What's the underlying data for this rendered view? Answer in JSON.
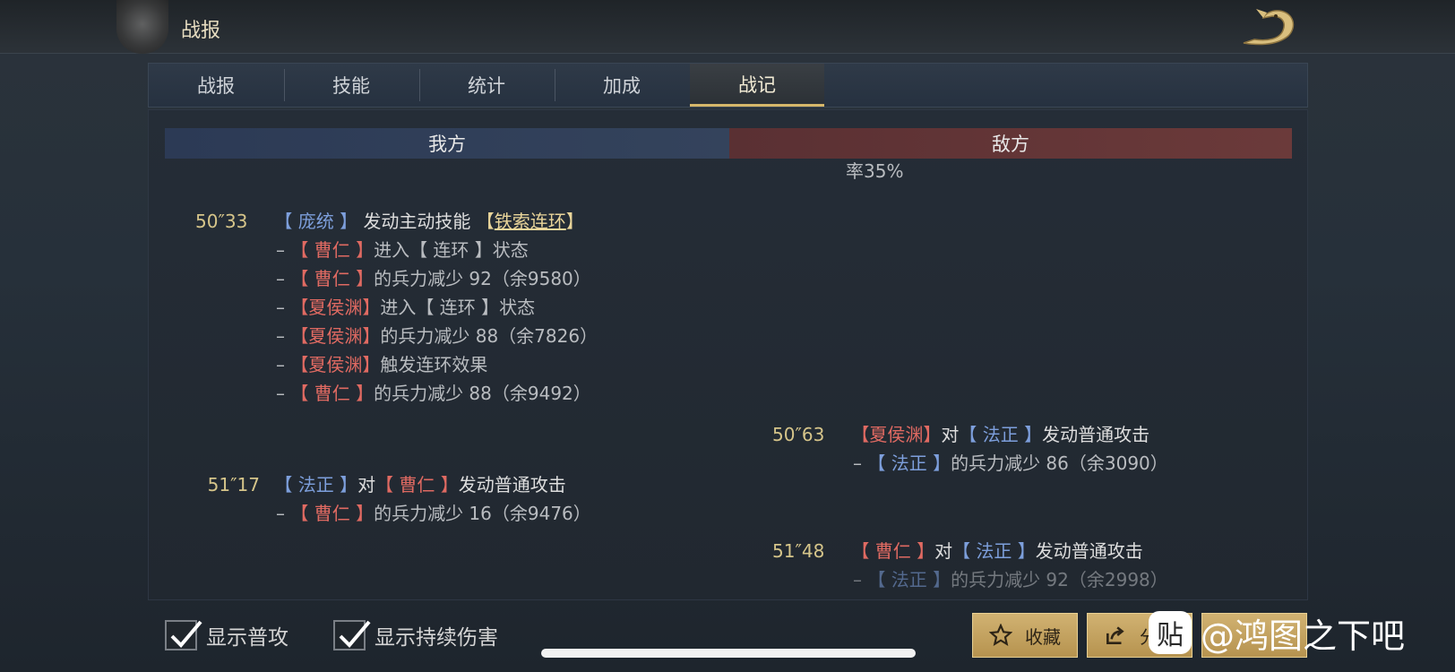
{
  "header": {
    "title": "战报"
  },
  "tabs": [
    {
      "label": "战报"
    },
    {
      "label": "技能"
    },
    {
      "label": "统计"
    },
    {
      "label": "加成"
    },
    {
      "label": "战记",
      "active": true
    }
  ],
  "sides": {
    "our": "我方",
    "enemy": "敌方"
  },
  "log": {
    "partial_top_line": "率35%",
    "e1": {
      "time": "50″33",
      "actor": "【 庞统 】",
      "verb": "发动主动技能",
      "skill_open": "【",
      "skill": "铁索连环",
      "skill_close": "】",
      "subs": [
        {
          "target": "【 曹仁 】",
          "pre": "进入",
          "status": "【 连环 】",
          "post": "状态"
        },
        {
          "target": "【 曹仁 】",
          "text": "的兵力减少 92（余9580）"
        },
        {
          "target": "【夏侯渊】",
          "pre": "进入",
          "status": "【 连环 】",
          "post": "状态"
        },
        {
          "target": "【夏侯渊】",
          "text": "的兵力减少 88（余7826）"
        },
        {
          "target": "【夏侯渊】",
          "text": "触发连环效果"
        },
        {
          "target": "【 曹仁 】",
          "text": "的兵力减少 88（余9492）"
        }
      ]
    },
    "e2": {
      "time": "50″63",
      "actor": "【夏侯渊】",
      "mid": "对",
      "target": "【 法正 】",
      "verb": "发动普通攻击",
      "sub_target": "【 法正 】",
      "sub_text": "的兵力减少 86（余3090）"
    },
    "e3": {
      "time": "51″17",
      "actor": "【 法正 】",
      "mid": "对",
      "target": "【 曹仁 】",
      "verb": "发动普通攻击",
      "sub_target": "【 曹仁 】",
      "sub_text": "的兵力减少 16（余9476）"
    },
    "e4": {
      "time": "51″48",
      "actor": "【 曹仁 】",
      "mid": "对",
      "target": "【 法正 】",
      "verb": "发动普通攻击",
      "sub_target": "【 法正 】",
      "sub_text": "的兵力减少 92（余2998）"
    }
  },
  "bottom": {
    "check1": "显示普攻",
    "check2": "显示持续伤害",
    "fav_label": "收藏",
    "share_label": "分"
  },
  "watermark": {
    "text": "@鸿图之下吧",
    "icon_char": "贴"
  },
  "colors": {
    "ally_name": "#7d9fdc",
    "enemy_name": "#e06a62",
    "time": "#d6c58a",
    "active_tab_underline": "#d6b76a",
    "button_gold": "#c9a862"
  },
  "icons": [
    "dragon-logo-icon",
    "check-icon",
    "star-icon",
    "share-icon"
  ]
}
